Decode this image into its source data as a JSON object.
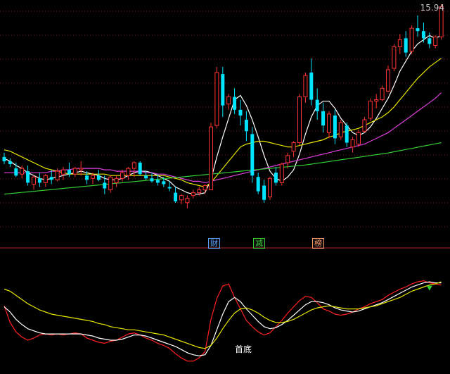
{
  "header": {
    "price_label": "15.94"
  },
  "markers": [
    {
      "text": "财",
      "color": "#5aa0ff"
    },
    {
      "text": "减",
      "color": "#33cc33"
    },
    {
      "text": "榜",
      "color": "#ff9966"
    }
  ],
  "bottom_label": "首底",
  "colors": {
    "up": "#ff3333",
    "down": "#00e5ff",
    "ma_white": "#ffffff",
    "ma_yellow": "#e6e600",
    "ma_magenta": "#e040e0",
    "ma_green": "#33cc33",
    "osc_red": "#ff2020",
    "osc_white": "#ffffff",
    "osc_yellow": "#e6e600",
    "grid": "#7a1a1a",
    "divider": "#b02020",
    "arrow": "#33cc33"
  },
  "chart_data": [
    {
      "type": "candlestick",
      "title": "",
      "xlabel": "",
      "ylabel": "",
      "last_price_label": "15.94",
      "ohlc": [
        [
          10.6,
          10.75,
          10.35,
          10.45
        ],
        [
          10.45,
          10.55,
          10.25,
          10.35
        ],
        [
          10.2,
          10.4,
          9.9,
          9.95
        ],
        [
          10.0,
          10.3,
          9.85,
          10.2
        ],
        [
          10.1,
          10.3,
          9.6,
          9.7
        ],
        [
          9.65,
          9.95,
          9.45,
          9.9
        ],
        [
          9.85,
          10.05,
          9.55,
          9.7
        ],
        [
          9.7,
          10.0,
          9.55,
          9.95
        ],
        [
          9.9,
          10.15,
          9.65,
          9.8
        ],
        [
          9.8,
          10.2,
          9.75,
          10.1
        ],
        [
          10.0,
          10.25,
          9.8,
          10.15
        ],
        [
          10.15,
          10.4,
          9.9,
          10.0
        ],
        [
          10.0,
          10.25,
          9.9,
          10.2
        ],
        [
          10.15,
          10.45,
          9.95,
          10.2
        ],
        [
          9.95,
          10.1,
          9.65,
          9.8
        ],
        [
          9.85,
          10.05,
          9.65,
          9.95
        ],
        [
          9.95,
          10.15,
          9.75,
          9.8
        ],
        [
          9.7,
          9.95,
          9.3,
          9.5
        ],
        [
          9.45,
          9.95,
          9.35,
          9.9
        ],
        [
          9.7,
          9.95,
          9.55,
          9.85
        ],
        [
          9.85,
          10.15,
          9.75,
          10.05
        ],
        [
          9.95,
          10.25,
          9.8,
          10.2
        ],
        [
          10.2,
          10.45,
          9.9,
          10.4
        ],
        [
          10.4,
          10.45,
          9.95,
          10.0
        ],
        [
          9.95,
          10.1,
          9.8,
          9.85
        ],
        [
          9.85,
          10.05,
          9.7,
          9.75
        ],
        [
          9.8,
          10.0,
          9.6,
          9.7
        ],
        [
          9.75,
          9.9,
          9.55,
          9.65
        ],
        [
          9.55,
          9.75,
          9.4,
          9.5
        ],
        [
          9.35,
          9.55,
          9.0,
          9.05
        ],
        [
          9.1,
          9.3,
          8.95,
          9.25
        ],
        [
          9.0,
          9.25,
          8.8,
          9.15
        ],
        [
          9.25,
          9.45,
          9.15,
          9.35
        ],
        [
          9.35,
          9.55,
          9.25,
          9.45
        ],
        [
          9.45,
          9.65,
          9.3,
          9.6
        ],
        [
          9.45,
          11.8,
          9.45,
          11.65
        ],
        [
          11.7,
          13.75,
          11.6,
          13.55
        ],
        [
          13.5,
          13.75,
          12.0,
          12.4
        ],
        [
          12.45,
          12.8,
          12.25,
          12.7
        ],
        [
          12.7,
          13.0,
          12.1,
          12.25
        ],
        [
          12.25,
          12.6,
          11.7,
          12.05
        ],
        [
          11.9,
          12.2,
          11.15,
          11.5
        ],
        [
          11.4,
          11.65,
          9.7,
          9.95
        ],
        [
          9.9,
          10.05,
          9.3,
          9.4
        ],
        [
          9.6,
          9.8,
          9.0,
          9.1
        ],
        [
          9.2,
          9.9,
          9.1,
          9.85
        ],
        [
          10.05,
          10.25,
          9.6,
          9.7
        ],
        [
          9.7,
          10.4,
          9.6,
          10.35
        ],
        [
          10.4,
          10.75,
          10.2,
          10.65
        ],
        [
          10.8,
          11.15,
          10.6,
          11.1
        ],
        [
          11.1,
          12.8,
          11.0,
          12.7
        ],
        [
          12.7,
          13.55,
          12.5,
          13.45
        ],
        [
          13.55,
          14.05,
          12.4,
          12.6
        ],
        [
          12.6,
          13.0,
          11.9,
          12.2
        ],
        [
          12.2,
          12.5,
          11.45,
          11.7
        ],
        [
          11.45,
          12.2,
          11.25,
          12.1
        ],
        [
          12.05,
          12.25,
          11.05,
          11.25
        ],
        [
          11.3,
          11.9,
          11.2,
          11.8
        ],
        [
          11.7,
          11.8,
          10.95,
          11.1
        ],
        [
          10.95,
          11.3,
          10.75,
          11.2
        ],
        [
          11.05,
          11.55,
          10.95,
          11.45
        ],
        [
          11.5,
          12.0,
          11.45,
          11.9
        ],
        [
          11.95,
          12.65,
          11.85,
          12.55
        ],
        [
          12.55,
          12.8,
          12.3,
          12.6
        ],
        [
          12.6,
          13.1,
          12.55,
          13.0
        ],
        [
          12.9,
          13.8,
          12.85,
          13.65
        ],
        [
          13.7,
          14.55,
          13.6,
          14.45
        ],
        [
          14.45,
          14.9,
          14.2,
          14.7
        ],
        [
          14.75,
          15.0,
          14.1,
          14.25
        ],
        [
          14.3,
          15.2,
          14.2,
          15.1
        ],
        [
          15.1,
          15.55,
          14.8,
          15.0
        ],
        [
          15.0,
          15.3,
          14.6,
          14.75
        ],
        [
          14.75,
          14.95,
          14.4,
          14.55
        ],
        [
          14.5,
          14.85,
          14.4,
          14.8
        ],
        [
          14.8,
          15.94,
          14.7,
          15.85
        ]
      ],
      "ma": [
        {
          "color": "#ffffff",
          "values": [
            10.55,
            10.45,
            10.3,
            10.2,
            10.05,
            9.95,
            9.85,
            9.8,
            9.85,
            9.9,
            9.95,
            10.0,
            10.05,
            10.1,
            10.05,
            10.0,
            9.95,
            9.85,
            9.8,
            9.8,
            9.85,
            9.95,
            10.05,
            10.1,
            10.1,
            10.05,
            9.95,
            9.85,
            9.75,
            9.55,
            9.45,
            9.35,
            9.3,
            9.3,
            9.35,
            9.8,
            10.6,
            11.3,
            11.95,
            12.6,
            12.75,
            12.4,
            11.9,
            11.3,
            10.65,
            10.1,
            9.85,
            9.75,
            9.9,
            10.15,
            10.7,
            11.4,
            12.0,
            12.4,
            12.55,
            12.55,
            12.3,
            11.95,
            11.7,
            11.45,
            11.35,
            11.45,
            11.65,
            11.95,
            12.3,
            12.65,
            13.1,
            13.6,
            13.95,
            14.3,
            14.55,
            14.7,
            14.85,
            14.75,
            14.85
          ]
        },
        {
          "color": "#e6e600",
          "values": [
            10.85,
            10.8,
            10.7,
            10.6,
            10.5,
            10.4,
            10.3,
            10.2,
            10.15,
            10.1,
            10.05,
            10.0,
            10.0,
            10.0,
            10.0,
            10.0,
            10.0,
            10.0,
            9.95,
            9.95,
            9.95,
            9.95,
            9.95,
            9.95,
            9.95,
            9.95,
            9.95,
            9.95,
            9.9,
            9.85,
            9.8,
            9.7,
            9.65,
            9.6,
            9.55,
            9.7,
            9.95,
            10.2,
            10.45,
            10.7,
            10.95,
            11.05,
            11.1,
            11.15,
            11.15,
            11.1,
            11.05,
            11.0,
            10.95,
            10.95,
            11.0,
            11.05,
            11.1,
            11.15,
            11.2,
            11.3,
            11.35,
            11.45,
            11.5,
            11.55,
            11.6,
            11.7,
            11.8,
            11.9,
            12.0,
            12.15,
            12.35,
            12.6,
            12.85,
            13.1,
            13.35,
            13.55,
            13.75,
            13.9,
            14.05
          ]
        },
        {
          "color": "#e040e0",
          "values": [
            10.05,
            10.05,
            10.05,
            10.05,
            10.05,
            10.05,
            10.05,
            10.05,
            10.1,
            10.1,
            10.15,
            10.15,
            10.2,
            10.2,
            10.2,
            10.2,
            10.2,
            10.15,
            10.15,
            10.1,
            10.1,
            10.1,
            10.1,
            10.1,
            10.05,
            10.05,
            10.0,
            10.0,
            9.95,
            9.9,
            9.85,
            9.8,
            9.75,
            9.75,
            9.7,
            9.75,
            9.8,
            9.85,
            9.9,
            9.95,
            10.0,
            10.05,
            10.1,
            10.15,
            10.2,
            10.25,
            10.3,
            10.35,
            10.4,
            10.45,
            10.5,
            10.55,
            10.6,
            10.65,
            10.7,
            10.75,
            10.8,
            10.85,
            10.9,
            10.95,
            11.0,
            11.05,
            11.15,
            11.25,
            11.35,
            11.45,
            11.6,
            11.75,
            11.9,
            12.05,
            12.2,
            12.35,
            12.5,
            12.65,
            12.85
          ]
        },
        {
          "color": "#33cc33",
          "values": [
            9.3,
            9.32,
            9.34,
            9.36,
            9.38,
            9.4,
            9.42,
            9.44,
            9.46,
            9.48,
            9.5,
            9.52,
            9.54,
            9.56,
            9.58,
            9.6,
            9.62,
            9.64,
            9.66,
            9.68,
            9.7,
            9.72,
            9.74,
            9.76,
            9.78,
            9.8,
            9.82,
            9.84,
            9.86,
            9.88,
            9.9,
            9.92,
            9.94,
            9.96,
            9.98,
            10.0,
            10.02,
            10.04,
            10.06,
            10.08,
            10.1,
            10.12,
            10.14,
            10.16,
            10.18,
            10.2,
            10.22,
            10.24,
            10.26,
            10.28,
            10.3,
            10.32,
            10.35,
            10.38,
            10.41,
            10.44,
            10.47,
            10.5,
            10.53,
            10.56,
            10.59,
            10.62,
            10.65,
            10.68,
            10.71,
            10.74,
            10.78,
            10.82,
            10.86,
            10.9,
            10.94,
            10.98,
            11.02,
            11.06,
            11.1
          ]
        }
      ]
    },
    {
      "type": "line",
      "title": "",
      "xlabel": "",
      "ylabel": "",
      "ylim": [
        0,
        100
      ],
      "series": [
        {
          "color": "#ff2020",
          "values": [
            58,
            42,
            33,
            28,
            25,
            27,
            30,
            31,
            30,
            31,
            30,
            31,
            32,
            31,
            27,
            25,
            23,
            22,
            24,
            25,
            28,
            31,
            32,
            30,
            27,
            25,
            22,
            20,
            17,
            12,
            8,
            5,
            5,
            8,
            14,
            45,
            65,
            77,
            79,
            66,
            55,
            44,
            38,
            33,
            30,
            32,
            38,
            44,
            51,
            57,
            63,
            67,
            66,
            61,
            55,
            53,
            50,
            49,
            50,
            52,
            55,
            57,
            60,
            62,
            64,
            68,
            71,
            74,
            76,
            79,
            81,
            82,
            80,
            79,
            78
          ]
        },
        {
          "color": "#ffffff",
          "values": [
            57,
            52,
            45,
            40,
            36,
            34,
            32,
            31,
            31,
            31,
            31,
            31,
            31,
            31,
            30,
            29,
            27,
            26,
            25,
            25,
            26,
            28,
            30,
            30,
            29,
            27,
            25,
            23,
            21,
            19,
            16,
            13,
            11,
            10,
            11,
            20,
            35,
            50,
            62,
            66,
            62,
            55,
            49,
            43,
            38,
            36,
            37,
            40,
            44,
            49,
            54,
            59,
            62,
            62,
            61,
            59,
            56,
            54,
            53,
            52,
            53,
            55,
            57,
            59,
            61,
            64,
            67,
            70,
            73,
            76,
            78,
            80,
            81,
            80,
            80
          ]
        },
        {
          "color": "#e6e600",
          "values": [
            74,
            72,
            68,
            64,
            60,
            57,
            54,
            52,
            50,
            49,
            48,
            47,
            46,
            45,
            44,
            43,
            41,
            40,
            38,
            37,
            36,
            35,
            35,
            34,
            33,
            32,
            31,
            30,
            28,
            26,
            24,
            22,
            20,
            18,
            17,
            20,
            27,
            36,
            44,
            51,
            55,
            56,
            54,
            51,
            47,
            44,
            42,
            42,
            43,
            45,
            48,
            51,
            54,
            56,
            57,
            58,
            57,
            56,
            55,
            55,
            55,
            56,
            57,
            58,
            60,
            62,
            64,
            66,
            69,
            72,
            74,
            76,
            78,
            79,
            81
          ]
        }
      ]
    }
  ]
}
